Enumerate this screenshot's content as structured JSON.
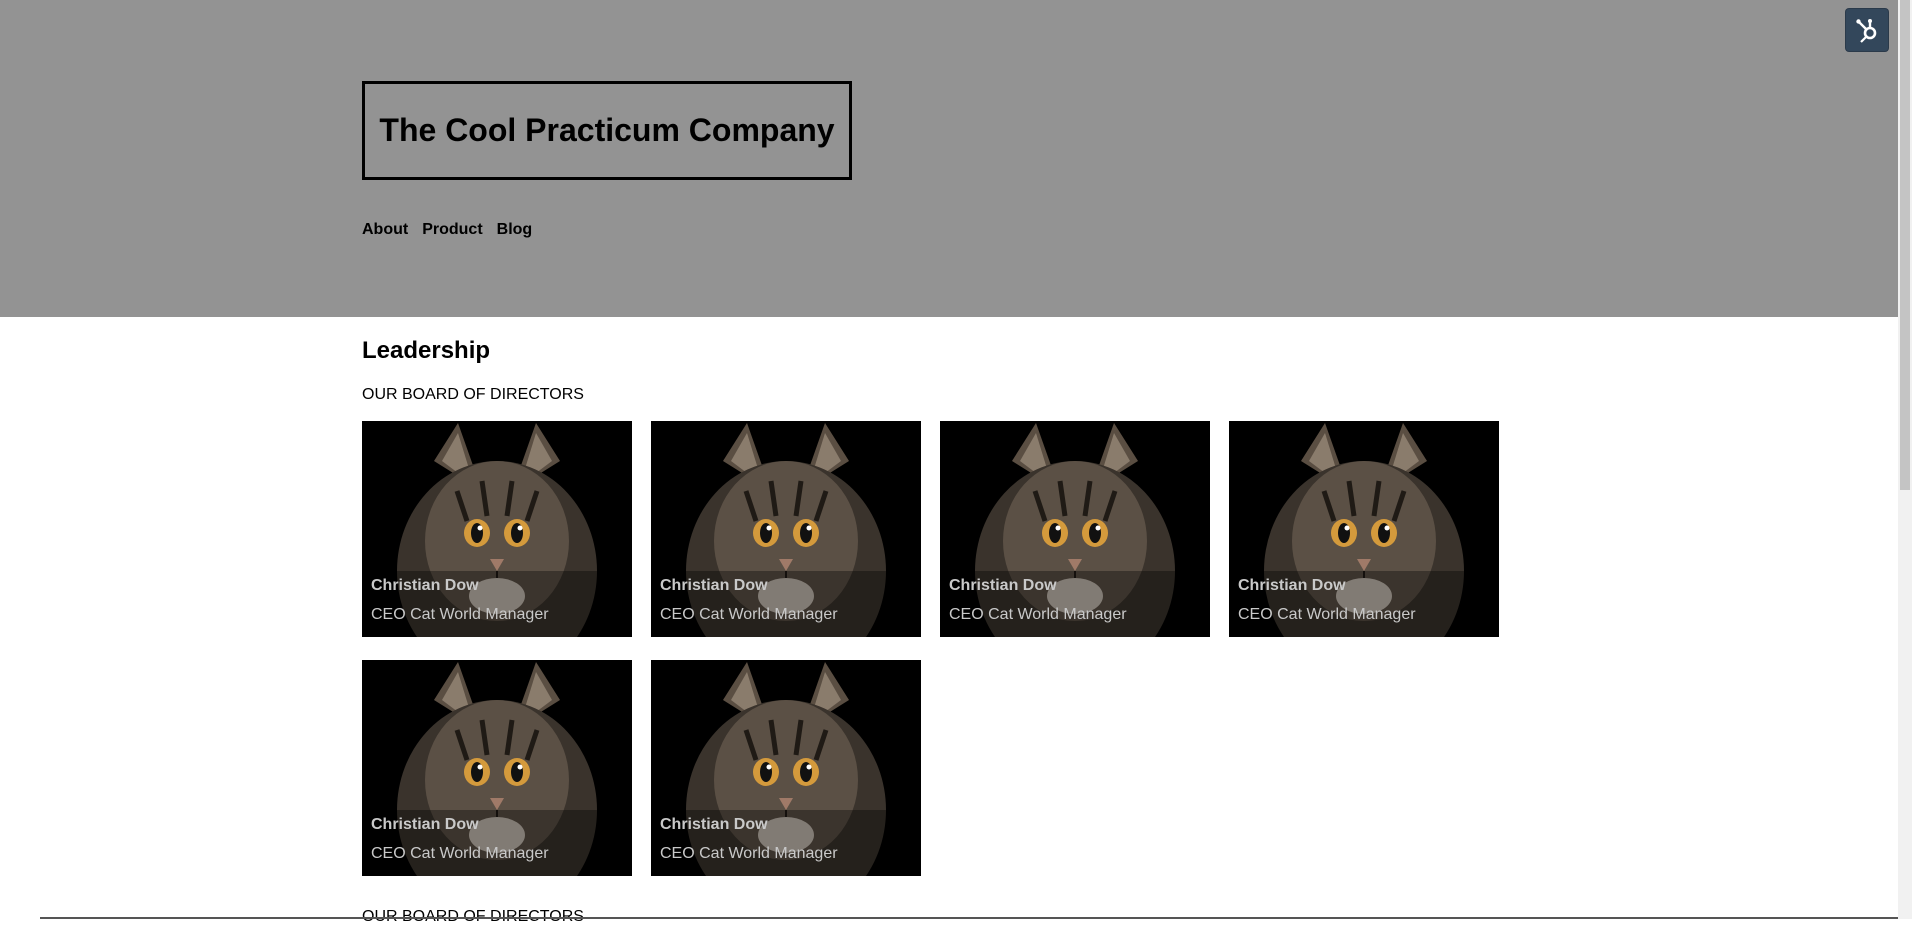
{
  "header": {
    "logo_text": "The Cool Practicum Company",
    "nav": [
      {
        "label": "About"
      },
      {
        "label": "Product"
      },
      {
        "label": "Blog"
      }
    ],
    "background": "#939393"
  },
  "hub_button": {
    "icon": "hubspot-sprocket-icon",
    "color": "#33475b"
  },
  "leadership": {
    "title": "Leadership",
    "subtitle": "OUR BOARD OF DIRECTORS",
    "cards": [
      {
        "name": "Christian Dow",
        "role": "CEO Cat World Manager"
      },
      {
        "name": "Christian Dow",
        "role": "CEO Cat World Manager"
      },
      {
        "name": "Christian Dow",
        "role": "CEO Cat World Manager"
      },
      {
        "name": "Christian Dow",
        "role": "CEO Cat World Manager"
      },
      {
        "name": "Christian Dow",
        "role": "CEO Cat World Manager"
      },
      {
        "name": "Christian Dow",
        "role": "CEO Cat World Manager"
      }
    ],
    "next_section_cutoff": "OUR BOARD OF DIRECTORS"
  }
}
